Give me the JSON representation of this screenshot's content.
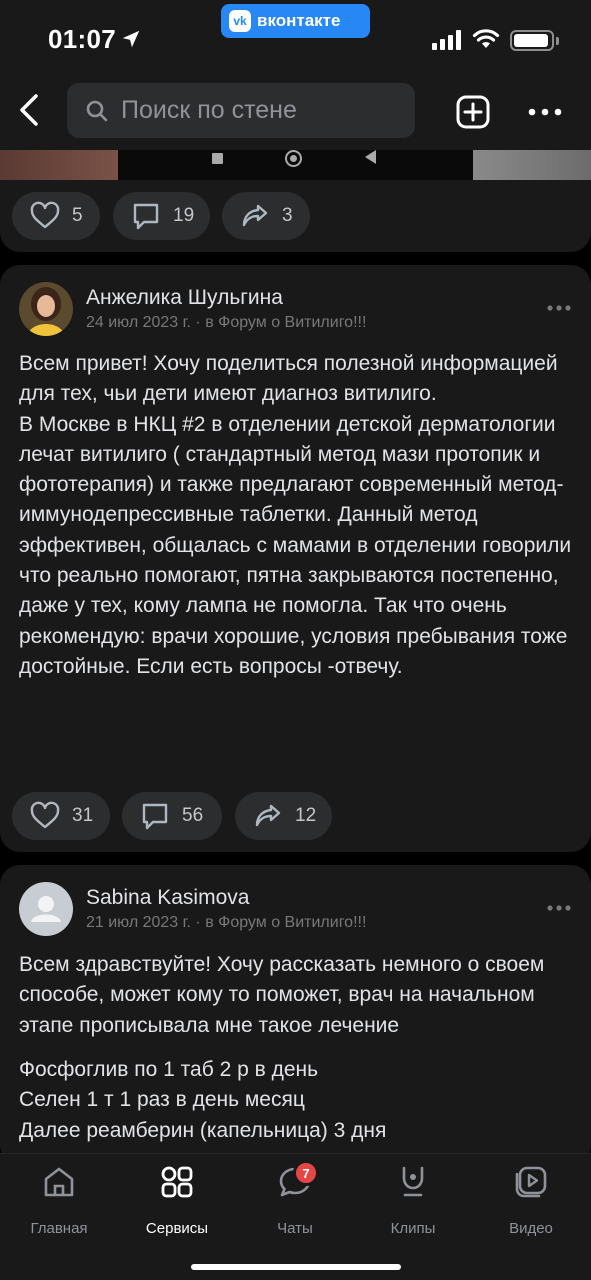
{
  "status_bar": {
    "time": "01:07",
    "app_badge": "вконтакте",
    "app_badge_logo": "vk"
  },
  "header": {
    "search_placeholder": "Поиск по стене"
  },
  "previous_post": {
    "likes": "5",
    "comments": "19",
    "reposts": "3"
  },
  "posts": [
    {
      "author": "Анжелика Шульгина",
      "date": "24 июл 2023 г.",
      "location": "в Форум о Витилиго!!!",
      "text": "Всем привет! Хочу поделиться полезной информацией для тех, чьи дети имеют диагноз витилиго.\nВ Москве в НКЦ #2  в отделении детской дерматологии лечат витилиго ( стандартный метод мази протопик и фототерапия) и также предлагают современный метод- иммунодепрессивные таблетки. Данный метод эффективен, общалась с мамами в отделении говорили что реально помогают, пятна закрываются постепенно, даже  у тех, кому лампа не помогла. Так что очень рекомендую: врачи хорошие, условия пребывания тоже достойные. Если есть вопросы -отвечу.",
      "likes": "31",
      "comments": "56",
      "reposts": "12"
    },
    {
      "author": "Sabina Kasimova",
      "date": "21 июл 2023 г.",
      "location": "в Форум о Витилиго!!!",
      "text": "Всем здравствуйте! Хочу рассказать немного о своем способе, может кому то поможет, врач на начальном этапе прописывала мне такое лечение",
      "text2": "Фосфоглив по 1 таб 2 р в день\nСелен 1 т 1 раз в день месяц\nДалее реамберин (капельница) 3 дня"
    }
  ],
  "separator": " · ",
  "tabbar": {
    "items": [
      {
        "label": "Главная",
        "icon": "home-icon"
      },
      {
        "label": "Сервисы",
        "icon": "services-icon"
      },
      {
        "label": "Чаты",
        "icon": "chat-icon",
        "badge": "7"
      },
      {
        "label": "Клипы",
        "icon": "clips-icon"
      },
      {
        "label": "Видео",
        "icon": "video-icon"
      }
    ]
  },
  "colors": {
    "background": "#000000",
    "card": "#191919",
    "pill": "#2c2d2e",
    "accent": "#2787f5",
    "badge": "#e64646",
    "secondary_text": "#76787a"
  }
}
